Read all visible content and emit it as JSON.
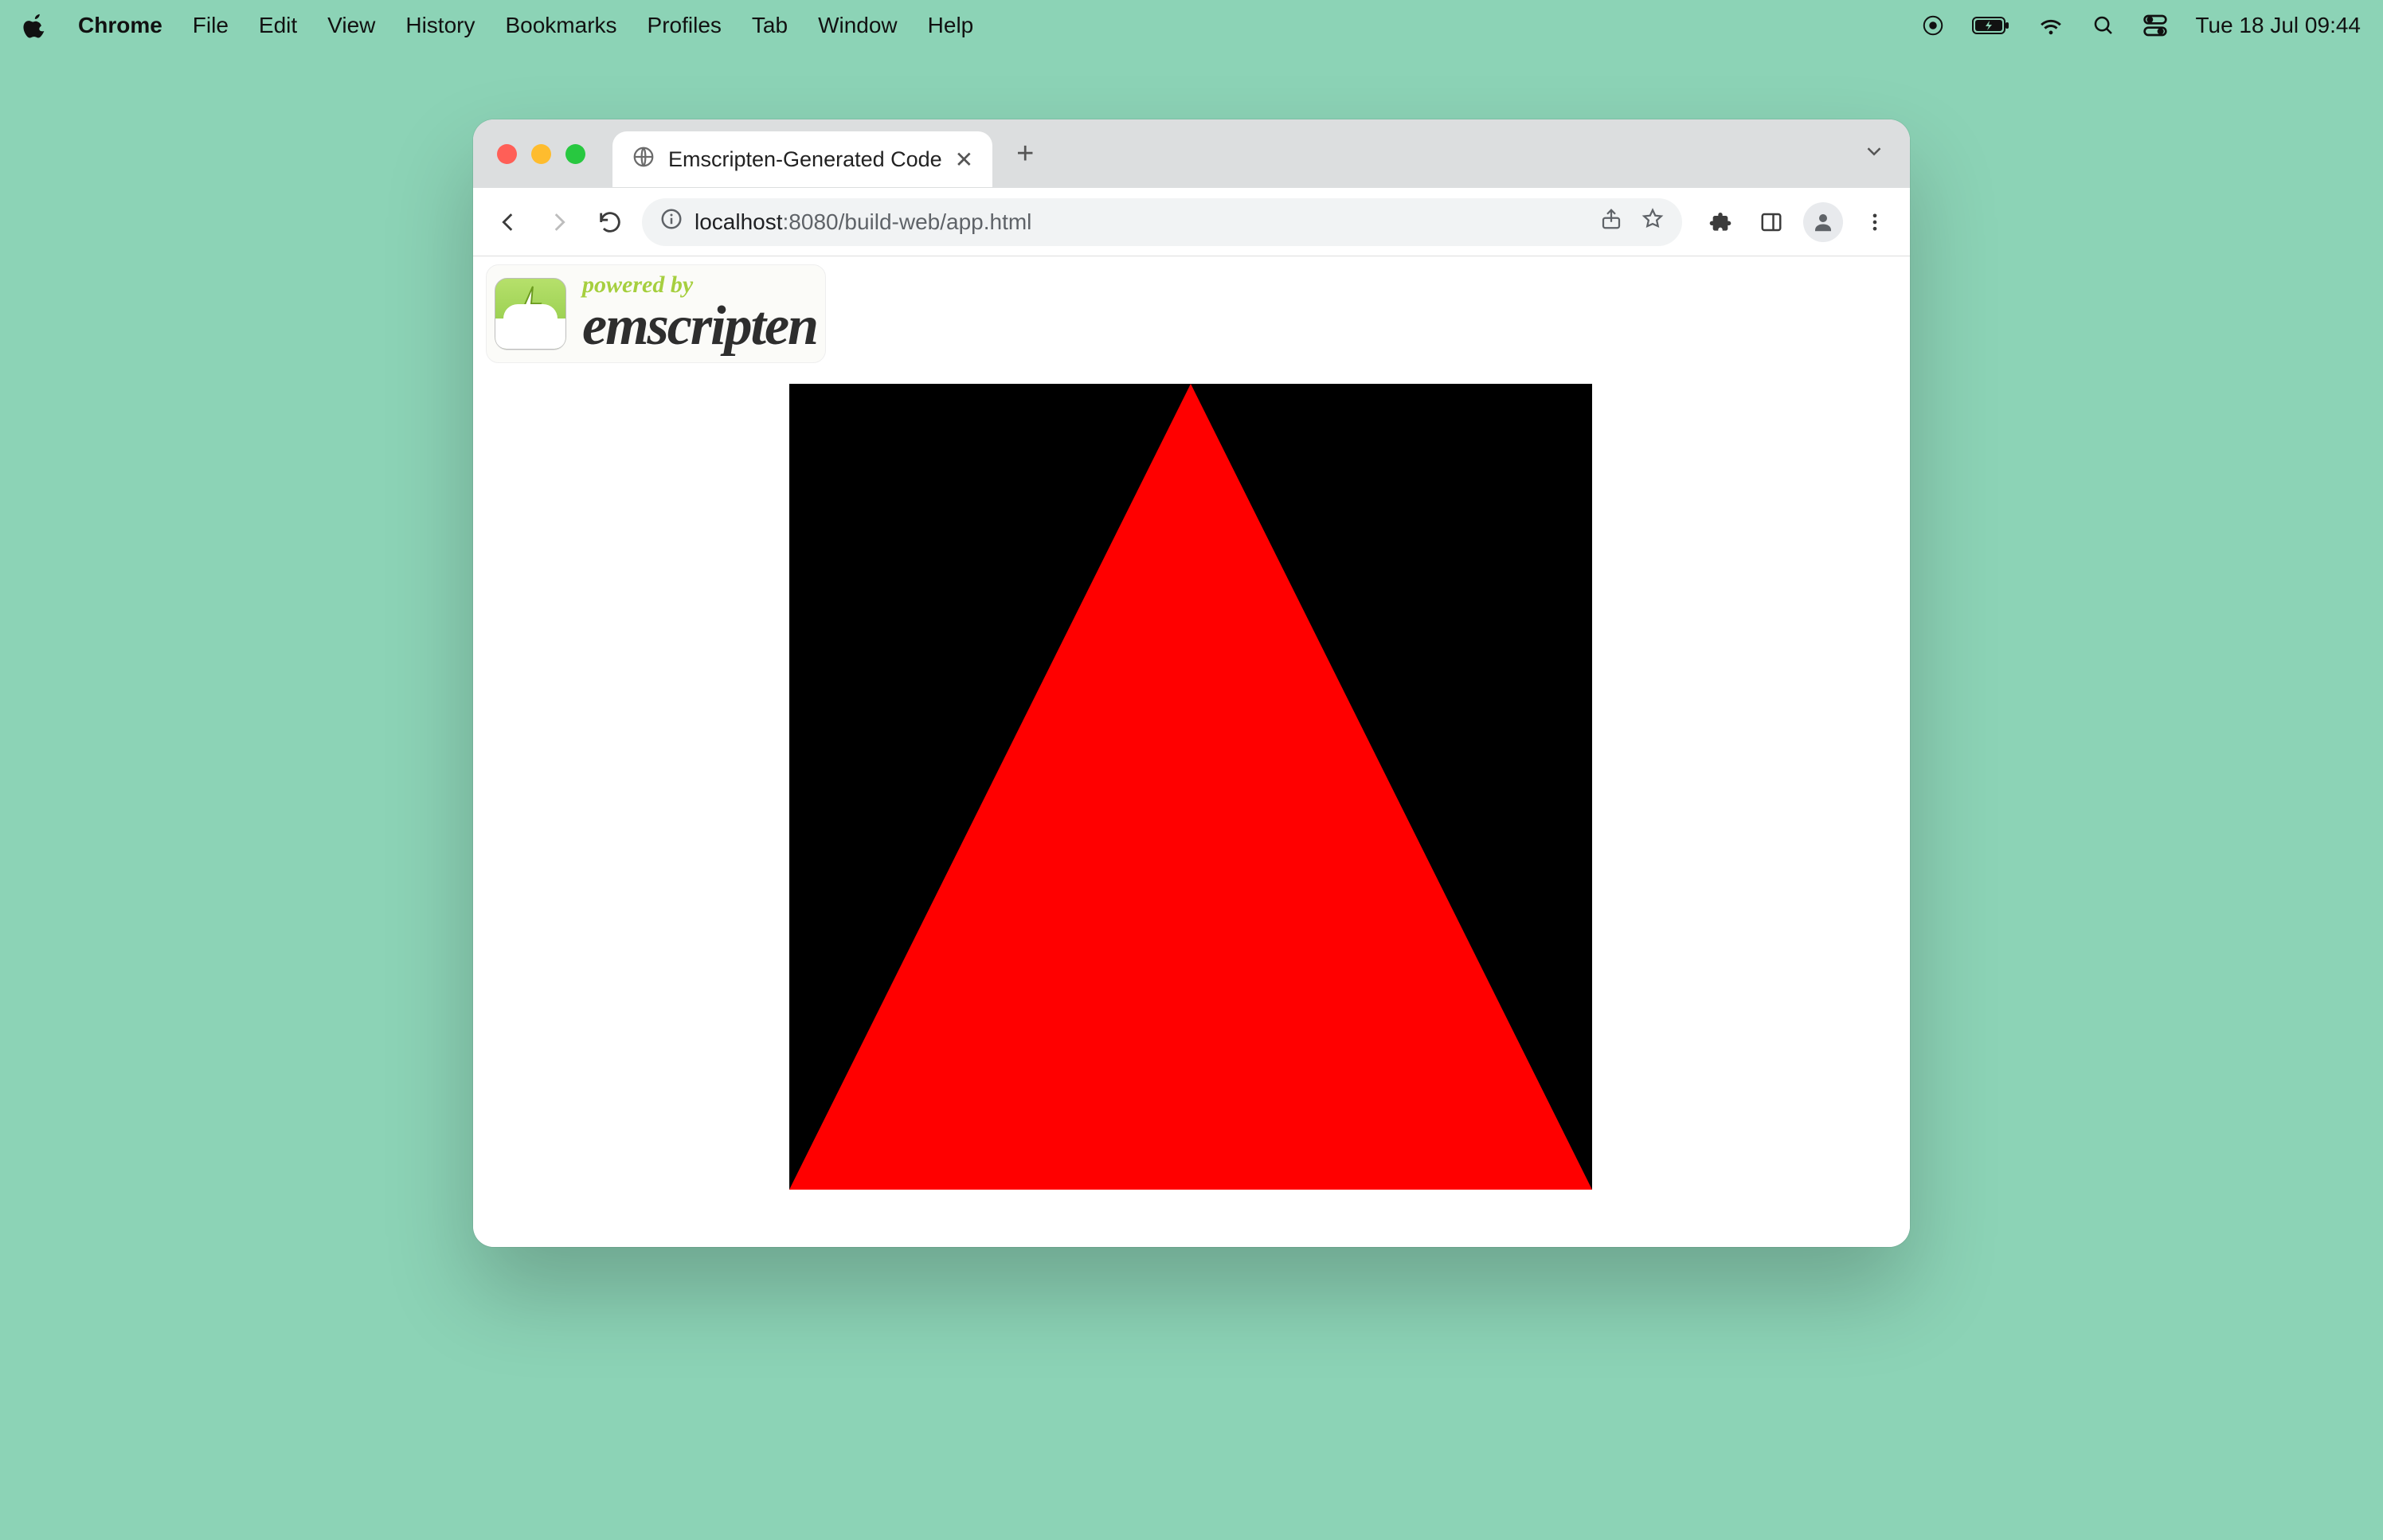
{
  "menubar": {
    "app": "Chrome",
    "items": [
      "File",
      "Edit",
      "View",
      "History",
      "Bookmarks",
      "Profiles",
      "Tab",
      "Window",
      "Help"
    ],
    "clock": "Tue 18 Jul  09:44"
  },
  "window": {
    "tab": {
      "title": "Emscripten-Generated Code"
    },
    "url": {
      "host": "localhost",
      "port": ":8080",
      "path": "/build-web/app.html"
    }
  },
  "page": {
    "poweredby": "powered by",
    "emscripten": "emscripten"
  }
}
